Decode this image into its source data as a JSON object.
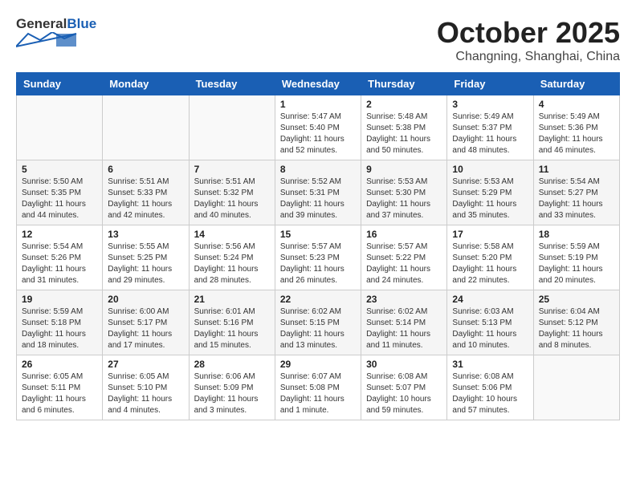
{
  "header": {
    "logo": {
      "general": "General",
      "blue": "Blue"
    },
    "month": "October 2025",
    "location": "Changning, Shanghai, China"
  },
  "weekdays": [
    "Sunday",
    "Monday",
    "Tuesday",
    "Wednesday",
    "Thursday",
    "Friday",
    "Saturday"
  ],
  "weeks": [
    [
      {
        "day": "",
        "info": ""
      },
      {
        "day": "",
        "info": ""
      },
      {
        "day": "",
        "info": ""
      },
      {
        "day": "1",
        "info": "Sunrise: 5:47 AM\nSunset: 5:40 PM\nDaylight: 11 hours\nand 52 minutes."
      },
      {
        "day": "2",
        "info": "Sunrise: 5:48 AM\nSunset: 5:38 PM\nDaylight: 11 hours\nand 50 minutes."
      },
      {
        "day": "3",
        "info": "Sunrise: 5:49 AM\nSunset: 5:37 PM\nDaylight: 11 hours\nand 48 minutes."
      },
      {
        "day": "4",
        "info": "Sunrise: 5:49 AM\nSunset: 5:36 PM\nDaylight: 11 hours\nand 46 minutes."
      }
    ],
    [
      {
        "day": "5",
        "info": "Sunrise: 5:50 AM\nSunset: 5:35 PM\nDaylight: 11 hours\nand 44 minutes."
      },
      {
        "day": "6",
        "info": "Sunrise: 5:51 AM\nSunset: 5:33 PM\nDaylight: 11 hours\nand 42 minutes."
      },
      {
        "day": "7",
        "info": "Sunrise: 5:51 AM\nSunset: 5:32 PM\nDaylight: 11 hours\nand 40 minutes."
      },
      {
        "day": "8",
        "info": "Sunrise: 5:52 AM\nSunset: 5:31 PM\nDaylight: 11 hours\nand 39 minutes."
      },
      {
        "day": "9",
        "info": "Sunrise: 5:53 AM\nSunset: 5:30 PM\nDaylight: 11 hours\nand 37 minutes."
      },
      {
        "day": "10",
        "info": "Sunrise: 5:53 AM\nSunset: 5:29 PM\nDaylight: 11 hours\nand 35 minutes."
      },
      {
        "day": "11",
        "info": "Sunrise: 5:54 AM\nSunset: 5:27 PM\nDaylight: 11 hours\nand 33 minutes."
      }
    ],
    [
      {
        "day": "12",
        "info": "Sunrise: 5:54 AM\nSunset: 5:26 PM\nDaylight: 11 hours\nand 31 minutes."
      },
      {
        "day": "13",
        "info": "Sunrise: 5:55 AM\nSunset: 5:25 PM\nDaylight: 11 hours\nand 29 minutes."
      },
      {
        "day": "14",
        "info": "Sunrise: 5:56 AM\nSunset: 5:24 PM\nDaylight: 11 hours\nand 28 minutes."
      },
      {
        "day": "15",
        "info": "Sunrise: 5:57 AM\nSunset: 5:23 PM\nDaylight: 11 hours\nand 26 minutes."
      },
      {
        "day": "16",
        "info": "Sunrise: 5:57 AM\nSunset: 5:22 PM\nDaylight: 11 hours\nand 24 minutes."
      },
      {
        "day": "17",
        "info": "Sunrise: 5:58 AM\nSunset: 5:20 PM\nDaylight: 11 hours\nand 22 minutes."
      },
      {
        "day": "18",
        "info": "Sunrise: 5:59 AM\nSunset: 5:19 PM\nDaylight: 11 hours\nand 20 minutes."
      }
    ],
    [
      {
        "day": "19",
        "info": "Sunrise: 5:59 AM\nSunset: 5:18 PM\nDaylight: 11 hours\nand 18 minutes."
      },
      {
        "day": "20",
        "info": "Sunrise: 6:00 AM\nSunset: 5:17 PM\nDaylight: 11 hours\nand 17 minutes."
      },
      {
        "day": "21",
        "info": "Sunrise: 6:01 AM\nSunset: 5:16 PM\nDaylight: 11 hours\nand 15 minutes."
      },
      {
        "day": "22",
        "info": "Sunrise: 6:02 AM\nSunset: 5:15 PM\nDaylight: 11 hours\nand 13 minutes."
      },
      {
        "day": "23",
        "info": "Sunrise: 6:02 AM\nSunset: 5:14 PM\nDaylight: 11 hours\nand 11 minutes."
      },
      {
        "day": "24",
        "info": "Sunrise: 6:03 AM\nSunset: 5:13 PM\nDaylight: 11 hours\nand 10 minutes."
      },
      {
        "day": "25",
        "info": "Sunrise: 6:04 AM\nSunset: 5:12 PM\nDaylight: 11 hours\nand 8 minutes."
      }
    ],
    [
      {
        "day": "26",
        "info": "Sunrise: 6:05 AM\nSunset: 5:11 PM\nDaylight: 11 hours\nand 6 minutes."
      },
      {
        "day": "27",
        "info": "Sunrise: 6:05 AM\nSunset: 5:10 PM\nDaylight: 11 hours\nand 4 minutes."
      },
      {
        "day": "28",
        "info": "Sunrise: 6:06 AM\nSunset: 5:09 PM\nDaylight: 11 hours\nand 3 minutes."
      },
      {
        "day": "29",
        "info": "Sunrise: 6:07 AM\nSunset: 5:08 PM\nDaylight: 11 hours\nand 1 minute."
      },
      {
        "day": "30",
        "info": "Sunrise: 6:08 AM\nSunset: 5:07 PM\nDaylight: 10 hours\nand 59 minutes."
      },
      {
        "day": "31",
        "info": "Sunrise: 6:08 AM\nSunset: 5:06 PM\nDaylight: 10 hours\nand 57 minutes."
      },
      {
        "day": "",
        "info": ""
      }
    ]
  ]
}
